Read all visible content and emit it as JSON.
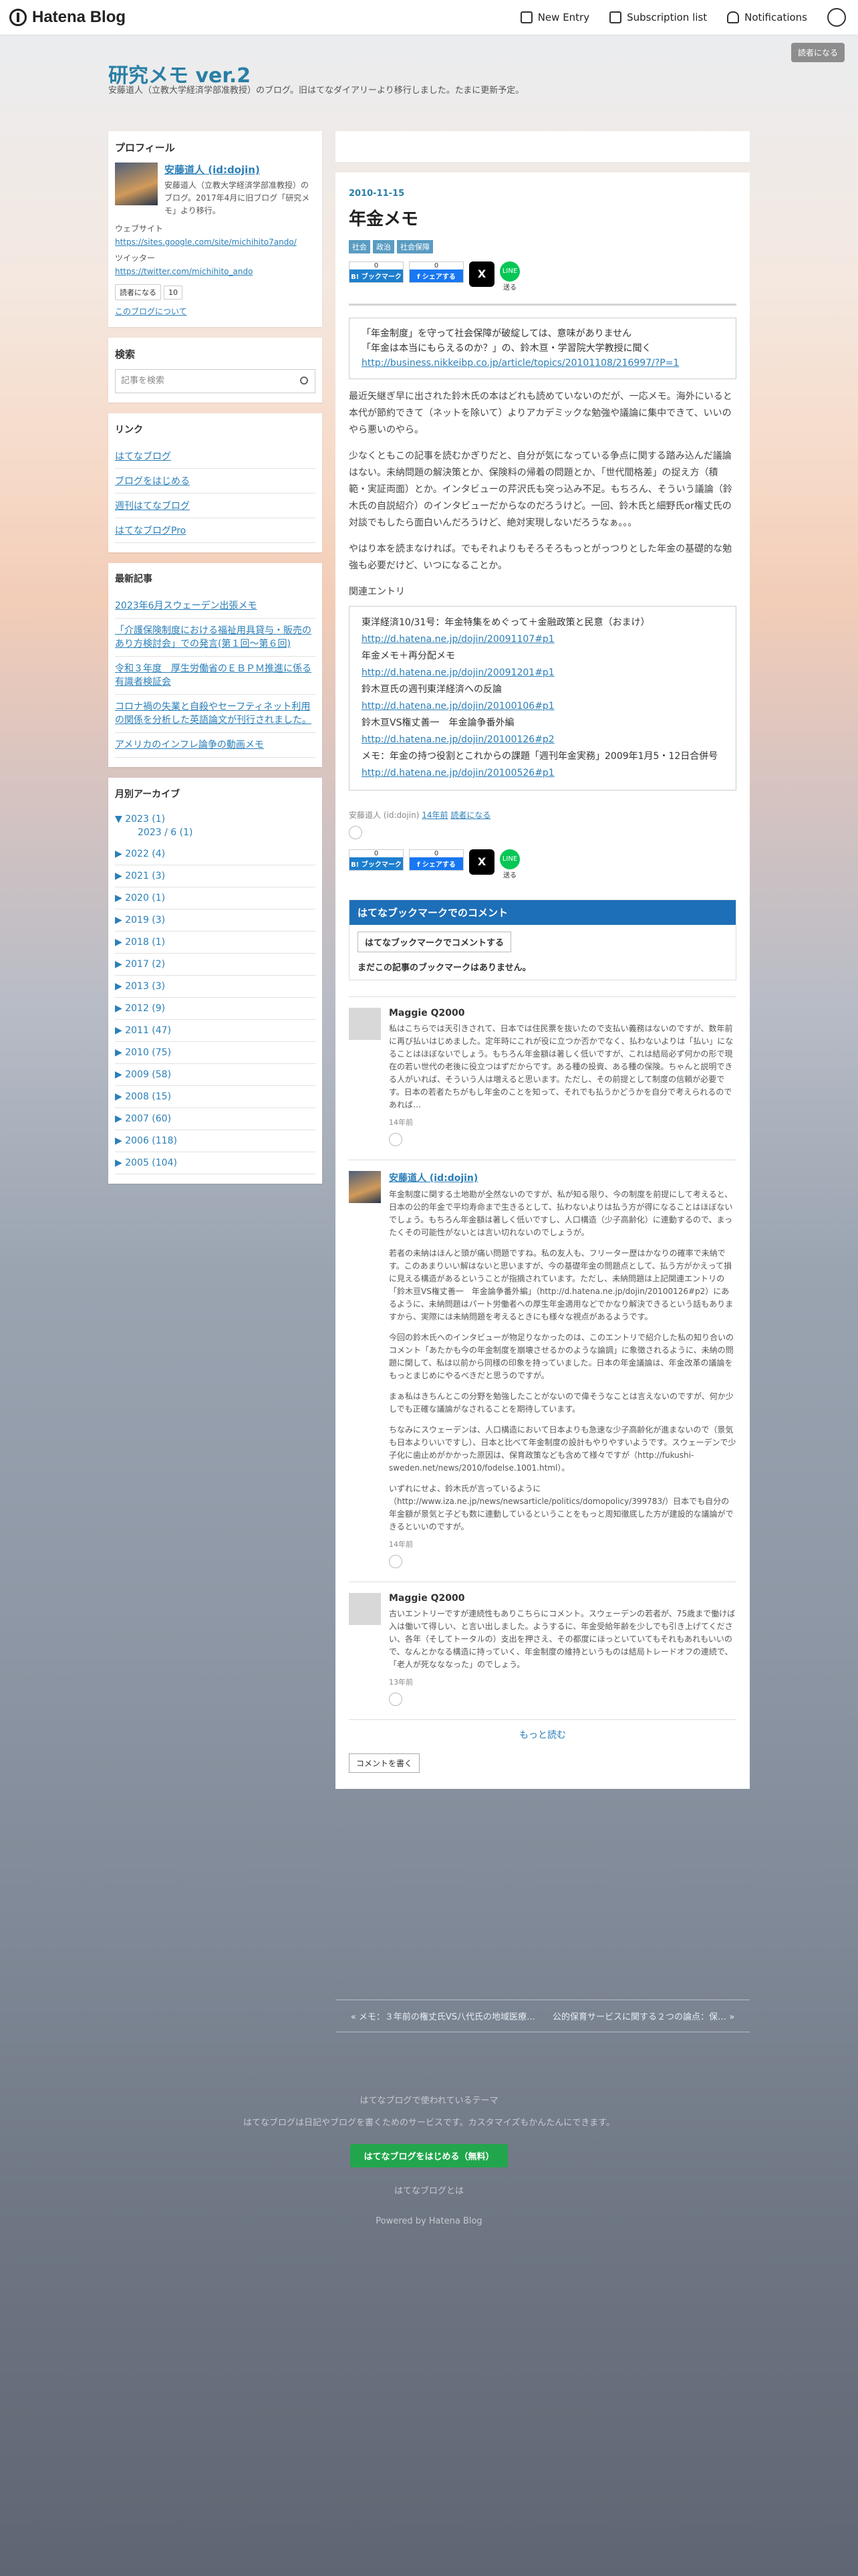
{
  "topbar": {
    "logo": "Hatena Blog",
    "new_entry": "New Entry",
    "subscription": "Subscription list",
    "notifications": "Notifications"
  },
  "header": {
    "title": "研究メモ ver.2",
    "description": "安藤道人（立教大学経済学部准教授）のブログ。旧はてなダイアリーより移行しました。たまに更新予定。",
    "reader_button": "読者になる"
  },
  "profile": {
    "heading": "プロフィール",
    "name": "安藤道人 (id:dojin)",
    "desc": "安藤道人（立教大学経済学部准教授）のブログ。2017年4月に旧ブログ「研究メモ」より移行。",
    "website_label": "ウェブサイト",
    "website_url": "https://sites.google.com/site/michihito7ando/",
    "twitter_label": "ツイッター",
    "twitter_url": "https://twitter.com/michihito_ando",
    "reader_button": "読者になる",
    "reader_count": "10",
    "about": "このブログについて"
  },
  "search": {
    "heading": "検索",
    "placeholder": "記事を検索"
  },
  "links": {
    "heading": "リンク",
    "items": [
      "はてなブログ",
      "ブログをはじめる",
      "週刊はてなブログ",
      "はてなブログPro"
    ]
  },
  "recent": {
    "heading": "最新記事",
    "items": [
      "2023年6月スウェーデン出張メモ",
      "「介護保険制度における福祉用具貸与・販売のあり方検討会」での発言(第１回〜第６回)",
      "令和３年度　厚生労働省のＥＢＰＭ推進に係る有識者検証会",
      "コロナ禍の失業と自殺やセーフティネット利用の関係を分析した英語論文が刊行されました。",
      "アメリカのインフレ論争の動画メモ"
    ]
  },
  "archive": {
    "heading": "月別アーカイブ",
    "open_year": "▼ 2023 (1)",
    "open_month": "2023 / 6 (1)",
    "years": [
      "▶ 2022 (4)",
      "▶ 2021 (3)",
      "▶ 2020 (1)",
      "▶ 2019 (3)",
      "▶ 2018 (1)",
      "▶ 2017 (2)",
      "▶ 2013 (3)",
      "▶ 2012 (9)",
      "▶ 2011 (47)",
      "▶ 2010 (75)",
      "▶ 2009 (58)",
      "▶ 2008 (15)",
      "▶ 2007 (60)",
      "▶ 2006 (118)",
      "▶ 2005 (104)"
    ]
  },
  "entry": {
    "date": "2010-11-15",
    "title": "年金メモ",
    "categories": [
      "社会",
      "政治",
      "社会保障"
    ],
    "bookmark_count": "0",
    "bookmark_label": "B! ブックマーク",
    "facebook_count": "0",
    "facebook_label": "f シェアする",
    "x_label": "X",
    "line_label": "LINE",
    "line_caption": "送る",
    "quote_line1": "「年金制度」を守って社会保障が破綻しては、意味がありません",
    "quote_line2": "「年金は本当にもらえるのか？」の、鈴木亘・学習院大学教授に聞く",
    "quote_link": "http://business.nikkeibp.co.jp/article/topics/20101108/216997/?P=1",
    "p1": "最近矢継ぎ早に出された鈴木氏の本はどれも読めていないのだが、一応メモ。海外にいると本代が節約できて（ネットを除いて）よりアカデミックな勉強や議論に集中できて、いいのやら悪いのやら。",
    "p2": "少なくともこの記事を読むかぎりだと、自分が気になっている争点に関する踏み込んだ議論はない。未納問題の解決策とか、保険料の帰着の問題とか、「世代間格差」の捉え方（積範・実証両面）とか。インタビューの芹沢氏も突っ込み不足。もちろん、そういう議論（鈴木氏の自説紹介）のインタビューだからなのだろうけど。一回、鈴木氏と細野氏or権丈氏の対談でもしたら面白いんだろうけど、絶対実現しないだろうなぁ。。。",
    "p3": "やはり本を読まなければ。でもそれよりもそろそろもっとがっつりとした年金の基礎的な勉強も必要だけど、いつになることか。",
    "related_heading": "関連エントリ",
    "related": [
      {
        "text": "東洋経済10/31号：年金特集をめぐって＋金融政策と民意（おまけ）",
        "link": "http://d.hatena.ne.jp/dojin/20091107#p1"
      },
      {
        "text": "年金メモ＋再分配メモ",
        "link": "http://d.hatena.ne.jp/dojin/20091201#p1"
      },
      {
        "text": "鈴木亘氏の週刊東洋経済への反論",
        "link": "http://d.hatena.ne.jp/dojin/20100106#p1"
      },
      {
        "text": "鈴木亘VS権丈善一　年金論争番外編",
        "link": "http://d.hatena.ne.jp/dojin/20100126#p2"
      },
      {
        "text": "メモ：年金の持つ役割とこれからの課題「週刊年金実務」2009年1月5・12日合併号",
        "link": "http://d.hatena.ne.jp/dojin/20100526#p1"
      }
    ],
    "footer_author": "安藤道人 (id:dojin)",
    "footer_time": "14年前",
    "footer_reader": "読者になる"
  },
  "bookmark_comments": {
    "heading": "はてなブックマークでのコメント",
    "button": "はてなブックマークでコメントする",
    "none": "まだこの記事のブックマークはありません。"
  },
  "comments": [
    {
      "name": "Maggie Q2000",
      "paras": [
        "私はこちらでは天引きされて、日本では住民票を抜いたので支払い義務はないのですが、数年前に再び払いはじめました。定年時にこれが役に立つか否かでなく、払わないよりは「払い」になることはほぼないでしょう。もちろん年金額は著しく低いですが、これは結局必ず何かの形で現在の若い世代の老後に役立つはずだからです。ある種の投資、ある種の保険。ちゃんと説明できる人がいれば、そういう人は増えると思います。ただし、その前提として制度の信頼が必要です。日本の若者たちがもし年金のことを知って、それでも払うかどうかを自分で考えられるのであれば…"
      ],
      "time": "14年前"
    },
    {
      "name": "安藤道人 (id:dojin)",
      "paras": [
        "年金制度に関する土地勘が全然ないのですが、私が知る限り、今の制度を前提にして考えると、日本の公的年金で平均寿命まで生きるとして、払わないよりは払う方が得になることはほぼないでしょう。もちろん年金額は著しく低いですし、人口構造（少子高齢化）に連動するので、まったくその可能性がないとは言い切れないのでしょうが。",
        "若者の未納はほんと頭が痛い問題ですね。私の友人も、フリーター歴はかなりの確率で未納です。このあまりいい解はないと思いますが、今の基礎年金の問題点として、払う方がかえって損に見える構造があるということが指摘されています。ただし、未納問題は上記関連エントリの「鈴木亘VS権丈善一　年金論争番外編」（http://d.hatena.ne.jp/dojin/20100126#p2）にあるように、未納問題はパート労働者への厚生年金適用などでかなり解決できるという話もありますから、実際には未納問題を考えるときにも様々な視点があるようです。",
        "今回の鈴木氏へのインタビューが物足りなかったのは、このエントリで紹介した私の知り合いのコメント「あたかも今の年金制度を崩壊させるかのような論調」に象徴されるように、未納の問題に関して、私は以前から同様の印象を持っていました。日本の年金議論は、年金改革の議論をもっとまじめにやるべきだと思うのですが。",
        "まぁ私はきちんとこの分野を勉強したことがないので偉そうなことは言えないのですが、何か少しでも正確な議論がなされることを期待しています。",
        "ちなみにスウェーデンは、人口構造において日本よりも急速な少子高齢化が進まないので（景気も日本よりいいですし）、日本と比べて年金制度の設計もやりやすいようです。スウェーデンで少子化に歯止めがかかった原因は、保育政策なども含めて様々ですが（http://fukushi-sweden.net/news/2010/fodelse.1001.html）。",
        "いずれにせよ、鈴木氏が言っているように（http://www.iza.ne.jp/news/newsarticle/politics/domopolicy/399783/）日本でも自分の年金額が景気と子ども数に連動しているということをもっと周知徹底した方が建設的な議論ができるといいのですが。"
      ],
      "time": "14年前"
    },
    {
      "name": "Maggie Q2000",
      "paras": [
        "古いエントリーですが連続性もありこちらにコメント。スウェーデンの若者が、75歳まで働けば入は働いて得しい、と言い出しました。ようするに、年金受給年齢を少しでも引き上げてください、各年（そしてトータルの）支出を押さえ、その都度にほっといていてもそれもあれもいいので、なんとかなる構造に持っていく、年金制度の維持というものは結局トレードオフの連続で、「老人が死なななった」のでしょう。"
      ],
      "time": "13年前"
    }
  ],
  "more_label": "もっと読む",
  "write_comment": "コメントを書く",
  "pager": "« メモ：３年前の権丈氏VS八代氏の地域医療…　　公的保育サービスに関する２つの論点：保… »",
  "footer": {
    "line1": "はてなブログで使われているテーマ",
    "line2": "はてなブログは日記やブログを書くためのサービスです。カスタマイズもかんたんにできます。",
    "button": "はてなブログをはじめる（無料）",
    "line3": "はてなブログとは",
    "line4": "Powered by Hatena Blog"
  }
}
